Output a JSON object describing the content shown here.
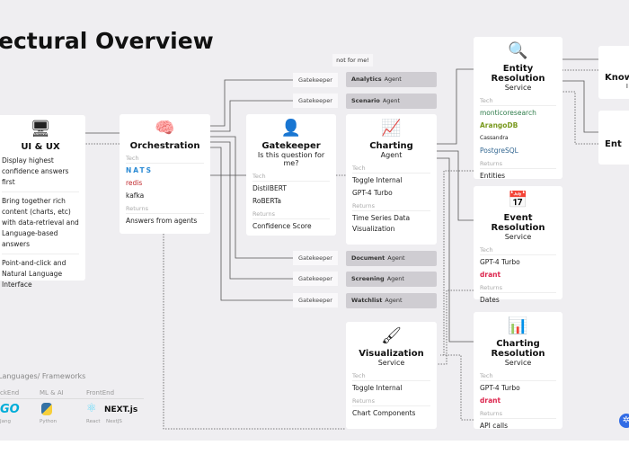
{
  "title": "ectural Overview",
  "note": "not for me!",
  "ui": {
    "title": "UI & UX",
    "icon": "monitor-icon",
    "points": [
      "Display highest confidence answers first",
      "Bring together rich content (charts, etc) with data-retrieval and Language-based answers",
      "Point-and-click and Natural Language Interface"
    ]
  },
  "orchestration": {
    "title": "Orchestration",
    "icon": "brain-icon",
    "tech_label": "Tech",
    "tech": [
      "NATS",
      "redis",
      "kafka"
    ],
    "returns_label": "Returns",
    "returns": "Answers from agents"
  },
  "gatekeeper": {
    "title": "Gatekeeper",
    "subtitle": "Is this question for me?",
    "tech_label": "Tech",
    "tech": [
      "DistilBERT",
      "RoBERTa"
    ],
    "returns_label": "Returns",
    "returns": "Confidence Score"
  },
  "charting": {
    "title": "Charting",
    "subtitle": "Agent",
    "tech_label": "Tech",
    "tech": [
      "Toggle Internal",
      "GPT-4 Turbo"
    ],
    "returns_label": "Returns",
    "returns": "Time Series Data Visualization"
  },
  "gatekeeper_label": "Gatekeeper",
  "agents": [
    {
      "name": "Analytics",
      "suffix": "Agent"
    },
    {
      "name": "Scenario",
      "suffix": "Agent"
    },
    {
      "name": "Document",
      "suffix": "Agent"
    },
    {
      "name": "Screening",
      "suffix": "Agent"
    },
    {
      "name": "Watchlist",
      "suffix": "Agent"
    }
  ],
  "visualization": {
    "title": "Visualization",
    "subtitle": "Service",
    "tech_label": "Tech",
    "tech": [
      "Toggle Internal"
    ],
    "returns_label": "Returns",
    "returns": "Chart Components"
  },
  "entity": {
    "title": "Entity Resolution",
    "subtitle": "Service",
    "tech_label": "Tech",
    "tech": [
      "monticoresearch",
      "ArangoDB",
      "Cassandra",
      "PostgreSQL"
    ],
    "returns_label": "Returns",
    "returns": "Entities"
  },
  "event": {
    "title": "Event Resolution",
    "subtitle": "Service",
    "tech_label": "Tech",
    "tech": [
      "GPT-4 Turbo",
      "drant"
    ],
    "returns_label": "Returns",
    "returns": "Dates"
  },
  "chartres": {
    "title": "Charting Resolution",
    "subtitle": "Service",
    "tech_label": "Tech",
    "tech": [
      "GPT-4 Turbo",
      "drant"
    ],
    "returns_label": "Returns",
    "returns": "API calls"
  },
  "right": {
    "know": "Know",
    "know_sub": "I",
    "ent": "Ent"
  },
  "languages": {
    "title": "Languages/ Frameworks",
    "groups": [
      {
        "label": "ckEnd",
        "items": [
          {
            "logo": "GO",
            "name": "Jang"
          }
        ]
      },
      {
        "label": "ML & AI",
        "items": [
          {
            "logo": "python-logo",
            "name": "Python"
          }
        ]
      },
      {
        "label": "FrontEnd",
        "items": [
          {
            "logo": "react-logo",
            "name": "React"
          },
          {
            "logo": "NEXT.js",
            "name": "NextJS"
          }
        ]
      }
    ]
  },
  "colors": {
    "background": "#efeef1",
    "agent": "#cfcdd2",
    "accent": "#f0b400",
    "go": "#00add8",
    "qdrant": "#dc244c"
  }
}
